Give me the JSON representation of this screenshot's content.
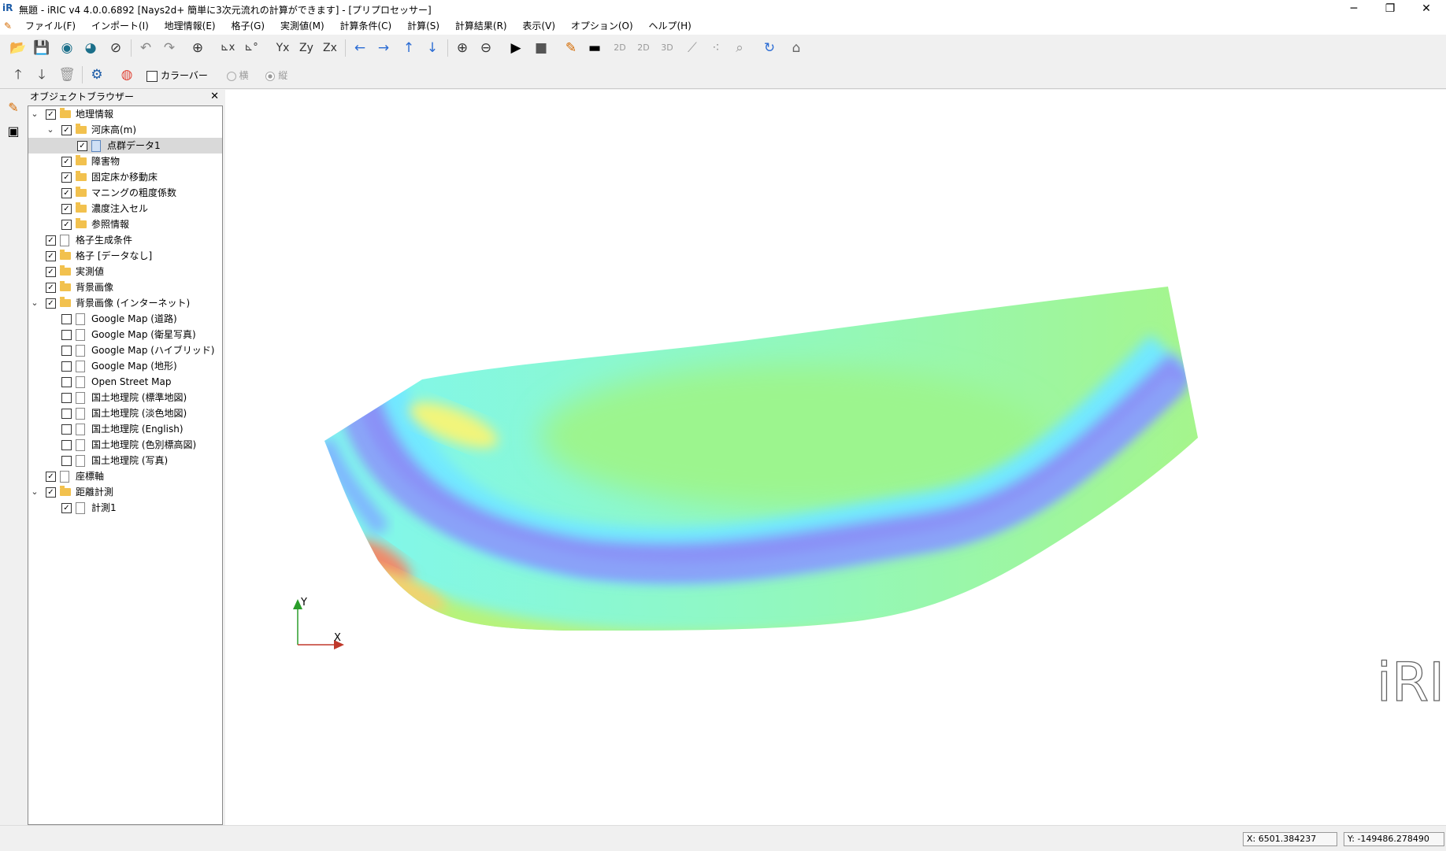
{
  "window": {
    "title": "無題 - iRIC v4 4.0.0.6892 [Nays2d+ 簡単に3次元流れの計算ができます] - [プリプロセッサー]",
    "logo": "iR",
    "minimize": "─",
    "restore": "❐",
    "close": "✕"
  },
  "menu": [
    "ファイル(F)",
    "インポート(I)",
    "地理情報(E)",
    "格子(G)",
    "実測値(M)",
    "計算条件(C)",
    "計算(S)",
    "計算結果(R)",
    "表示(V)",
    "オプション(O)",
    "ヘルプ(H)"
  ],
  "toolbar2": {
    "colorbar_label": "カラーバー",
    "horizontal_label": "横",
    "vertical_label": "縦"
  },
  "object_browser": {
    "title": "オブジェクトブラウザー",
    "close": "✕",
    "items": [
      {
        "label": "地理情報",
        "level": 0,
        "expanded": true,
        "checked": true,
        "icon": "folder"
      },
      {
        "label": "河床高(m)",
        "level": 1,
        "expanded": true,
        "checked": true,
        "icon": "folder"
      },
      {
        "label": "点群データ1",
        "level": 2,
        "checked": true,
        "icon": "file-blue",
        "selected": true
      },
      {
        "label": "障害物",
        "level": 1,
        "checked": true,
        "icon": "folder"
      },
      {
        "label": "固定床か移動床",
        "level": 1,
        "checked": true,
        "icon": "folder"
      },
      {
        "label": "マニングの粗度係数",
        "level": 1,
        "checked": true,
        "icon": "folder"
      },
      {
        "label": "濃度注入セル",
        "level": 1,
        "checked": true,
        "icon": "folder"
      },
      {
        "label": "参照情報",
        "level": 1,
        "checked": true,
        "icon": "folder"
      },
      {
        "label": "格子生成条件",
        "level": 0,
        "checked": true,
        "icon": "file"
      },
      {
        "label": "格子 [データなし]",
        "level": 0,
        "checked": true,
        "icon": "folder"
      },
      {
        "label": "実測値",
        "level": 0,
        "checked": true,
        "icon": "folder"
      },
      {
        "label": "背景画像",
        "level": 0,
        "checked": true,
        "icon": "folder"
      },
      {
        "label": "背景画像 (インターネット)",
        "level": 0,
        "expanded": true,
        "checked": true,
        "icon": "folder"
      },
      {
        "label": "Google Map (道路)",
        "level": 1,
        "checked": false,
        "icon": "file"
      },
      {
        "label": "Google Map (衛星写真)",
        "level": 1,
        "checked": false,
        "icon": "file"
      },
      {
        "label": "Google Map (ハイブリッド)",
        "level": 1,
        "checked": false,
        "icon": "file"
      },
      {
        "label": "Google Map (地形)",
        "level": 1,
        "checked": false,
        "icon": "file"
      },
      {
        "label": "Open Street Map",
        "level": 1,
        "checked": false,
        "icon": "file"
      },
      {
        "label": "国土地理院 (標準地図)",
        "level": 1,
        "checked": false,
        "icon": "file"
      },
      {
        "label": "国土地理院 (淡色地図)",
        "level": 1,
        "checked": false,
        "icon": "file"
      },
      {
        "label": "国土地理院 (English)",
        "level": 1,
        "checked": false,
        "icon": "file"
      },
      {
        "label": "国土地理院 (色別標高図)",
        "level": 1,
        "checked": false,
        "icon": "file"
      },
      {
        "label": "国土地理院 (写真)",
        "level": 1,
        "checked": false,
        "icon": "file"
      },
      {
        "label": "座標軸",
        "level": 0,
        "checked": true,
        "icon": "file"
      },
      {
        "label": "距離計測",
        "level": 0,
        "expanded": true,
        "checked": true,
        "icon": "folder"
      },
      {
        "label": "計測1",
        "level": 1,
        "checked": true,
        "icon": "file"
      }
    ]
  },
  "canvas": {
    "axis_x": "X",
    "axis_y": "Y",
    "watermark": "iRIC"
  },
  "status": {
    "x": "X: 6501.384237",
    "y": "Y: -149486.278490"
  }
}
